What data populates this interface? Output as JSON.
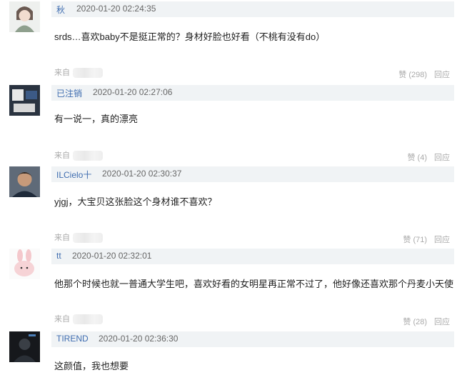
{
  "comments": [
    {
      "username": "秋",
      "time": "2020-01-20 02:24:35",
      "text": "srds…喜欢baby不是挺正常的？身材好脸也好看（不桃有没有do）",
      "source_label": "来自",
      "like_label": "赞",
      "like_count": "(298)",
      "reply_label": "回应"
    },
    {
      "username": "已注销",
      "time": "2020-01-20 02:27:06",
      "text": "有一说一，真的漂亮",
      "source_label": "来自",
      "like_label": "赞",
      "like_count": "(4)",
      "reply_label": "回应"
    },
    {
      "username": "ILCielo十",
      "time": "2020-01-20 02:30:37",
      "text": "yjgj，大宝贝这张脸这个身材谁不喜欢？",
      "source_label": "来自",
      "like_label": "赞",
      "like_count": "(71)",
      "reply_label": "回应"
    },
    {
      "username": "tt",
      "time": "2020-01-20 02:32:01",
      "text": "他那个时候也就一普通大学生吧，喜欢好看的女明星再正常不过了，他好像还喜欢那个丹麦小天使",
      "source_label": "来自",
      "like_label": "赞",
      "like_count": "(28)",
      "reply_label": "回应"
    },
    {
      "username": "TIREND",
      "time": "2020-01-20 02:36:30",
      "text": "这颜值，我也想要"
    }
  ]
}
